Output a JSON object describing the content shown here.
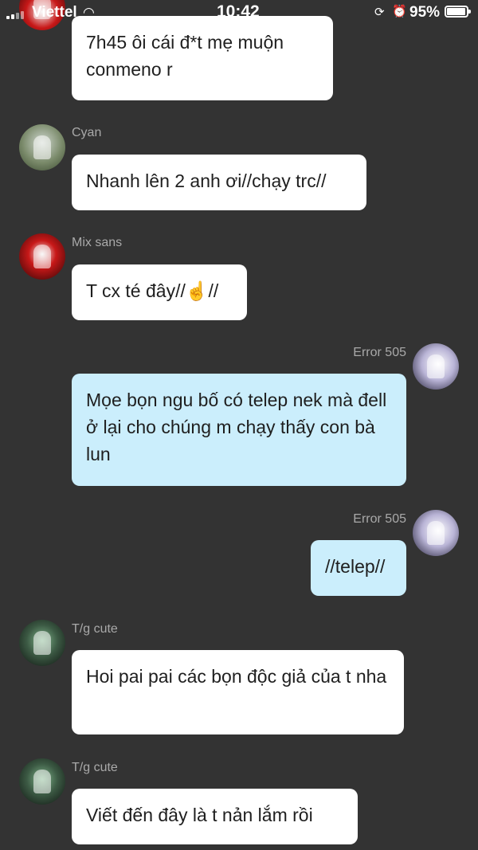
{
  "status_bar": {
    "carrier": "Viettel",
    "wifi_icon": "wifi-icon",
    "time": "10:42",
    "battery_percent": "95%",
    "battery_level": 0.95
  },
  "messages": [
    {
      "sender": "",
      "text": "7h45 ôi cái đ*t mẹ muộn conmeno r",
      "side": "left"
    },
    {
      "sender": "Cyan",
      "text": "Nhanh lên 2 anh ơi//chạy trc//",
      "side": "left"
    },
    {
      "sender": "Mix sans",
      "text": "T cx té đây//☝️//",
      "side": "left"
    },
    {
      "sender": "Error 505",
      "text": "Mọe bọn ngu bố có telep nek mà đell ở lại cho chúng m chạy thấy con bà lun",
      "side": "right"
    },
    {
      "sender": "Error 505",
      "text": "//telep//",
      "side": "right"
    },
    {
      "sender": "T/g cute",
      "text": "Hoi pai pai các bọn độc giả của t nha",
      "side": "left"
    },
    {
      "sender": "T/g cute",
      "text": "Viết đến đây là t nản lắm rồi",
      "side": "left"
    }
  ],
  "colors": {
    "background": "#333333",
    "incoming_bubble": "#ffffff",
    "outgoing_bubble": "#cbeefc",
    "username": "#a9a9a9"
  }
}
